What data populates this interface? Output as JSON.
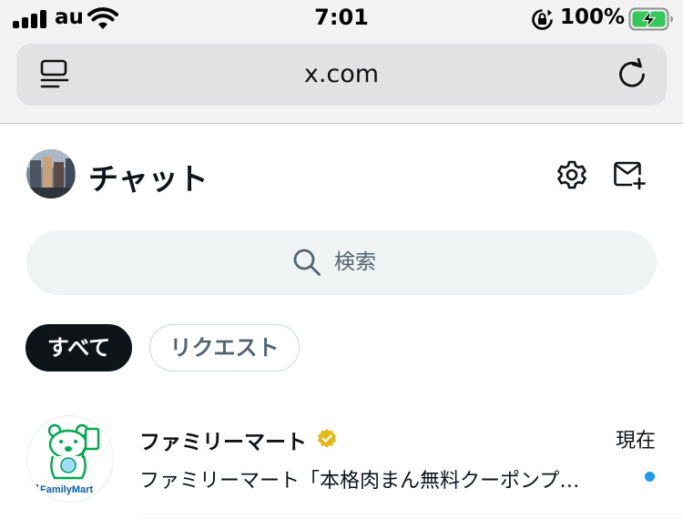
{
  "status_bar": {
    "carrier": "au",
    "time": "7:01",
    "battery_percent": "100%",
    "battery_level": 1.0,
    "charging": true,
    "icons": [
      "signal-icon",
      "wifi-icon",
      "orientation-lock-icon",
      "battery-charging-icon"
    ]
  },
  "browser": {
    "url": "x.com",
    "icons": [
      "reader-view-icon",
      "reload-icon"
    ]
  },
  "header": {
    "title": "チャット",
    "icons": [
      "settings-icon",
      "new-message-icon"
    ]
  },
  "search": {
    "placeholder": "検索"
  },
  "filters": [
    {
      "label": "すべて",
      "active": true
    },
    {
      "label": "リクエスト",
      "active": false
    }
  ],
  "conversations": [
    {
      "name": "ファミリーマート",
      "verified": true,
      "time": "現在",
      "preview": "ファミリーマート「本格肉まん無料クーポンプ…",
      "unread": true,
      "avatar_label": "FamilyMart"
    }
  ],
  "colors": {
    "accent": "#1d9bf0",
    "text_primary": "#0f1419",
    "text_secondary": "#536471",
    "verified_gold": "#e2b719",
    "familymart_green": "#00a94f",
    "battery_green": "#34c759"
  }
}
